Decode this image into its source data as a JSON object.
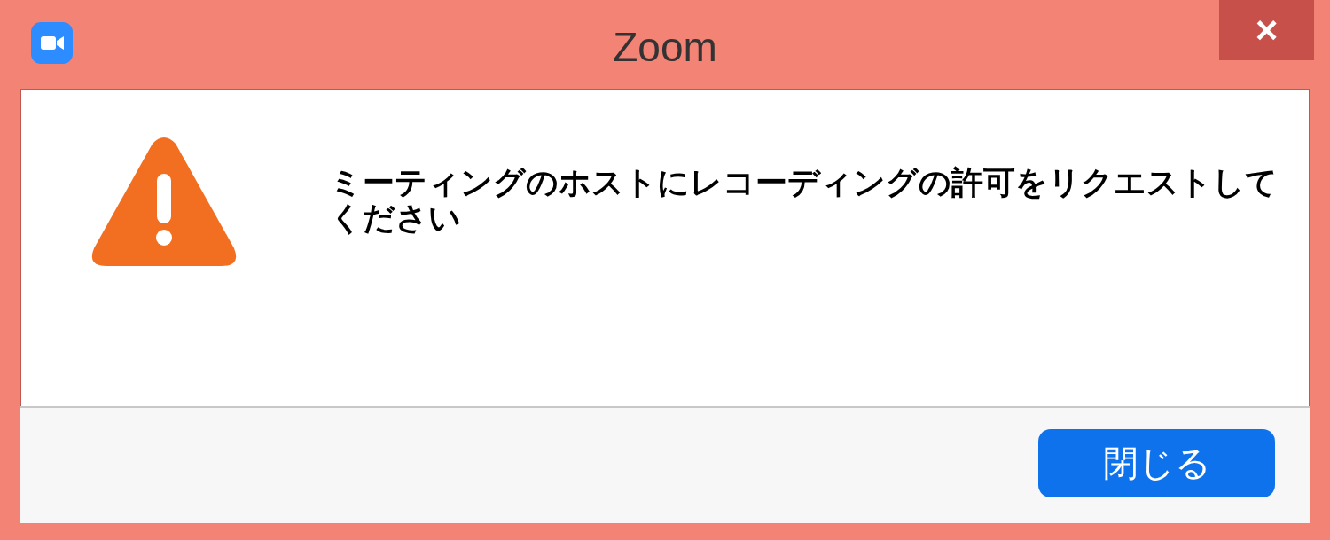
{
  "window": {
    "title": "Zoom",
    "close": "×"
  },
  "message": "ミーティングのホストにレコーディングの許可をリクエストしてください",
  "buttons": [
    "閉じる"
  ]
}
